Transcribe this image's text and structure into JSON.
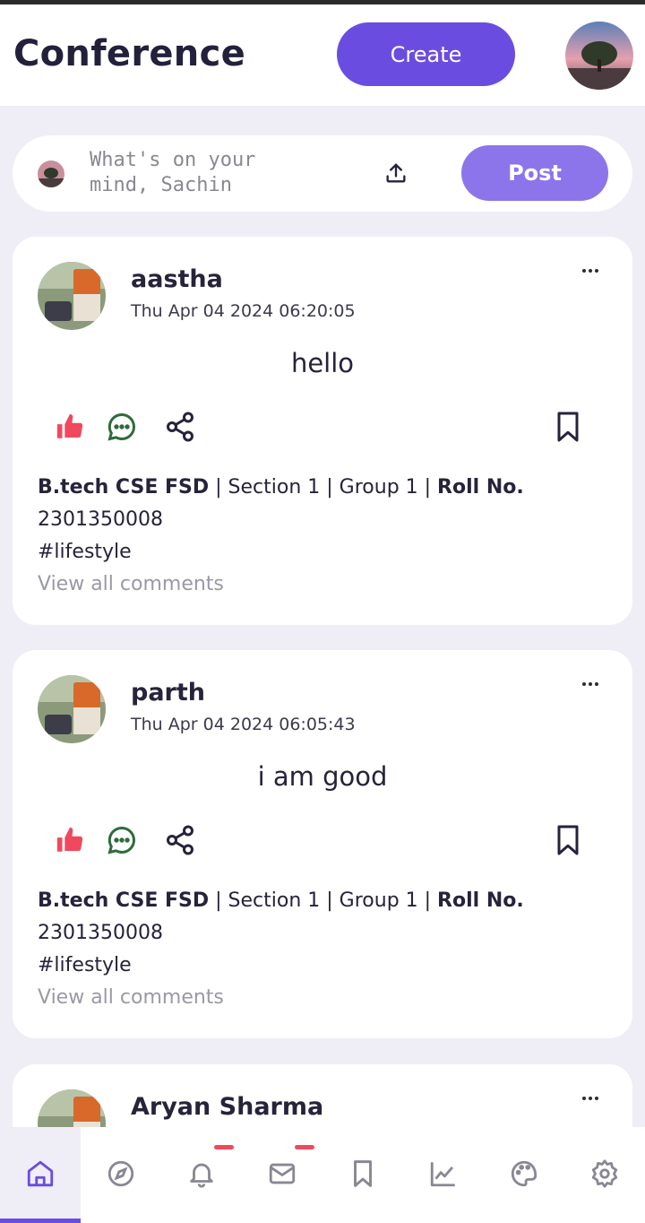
{
  "header": {
    "title": "Conference",
    "create_label": "Create"
  },
  "composer": {
    "placeholder": "What's on your mind, Sachin",
    "post_label": "Post"
  },
  "posts": [
    {
      "author": "aastha",
      "timestamp": "Thu Apr 04 2024 06:20:05",
      "content": "hello",
      "course": "B.tech CSE FSD",
      "section": " | Section 1 | Group 1 | ",
      "roll_label": "Roll No.",
      "roll": "2301350008",
      "tag": "#lifestyle",
      "view_comments": "View all comments"
    },
    {
      "author": "parth",
      "timestamp": "Thu Apr 04 2024 06:05:43",
      "content": "i am good",
      "course": "B.tech CSE FSD",
      "section": " | Section 1 | Group 1 | ",
      "roll_label": "Roll No.",
      "roll": "2301350008",
      "tag": "#lifestyle",
      "view_comments": "View all comments"
    },
    {
      "author": "Aryan Sharma"
    }
  ],
  "nav": {
    "items": [
      "home-icon",
      "compass-icon",
      "bell-icon",
      "mail-icon",
      "bookmark-icon",
      "chart-icon",
      "palette-icon",
      "gear-icon"
    ],
    "active": "home"
  },
  "colors": {
    "accent": "#6a4de0",
    "post_button": "#8c75ea",
    "like": "#f0495d",
    "comment": "#2f6b3a",
    "background": "#efeef6"
  }
}
